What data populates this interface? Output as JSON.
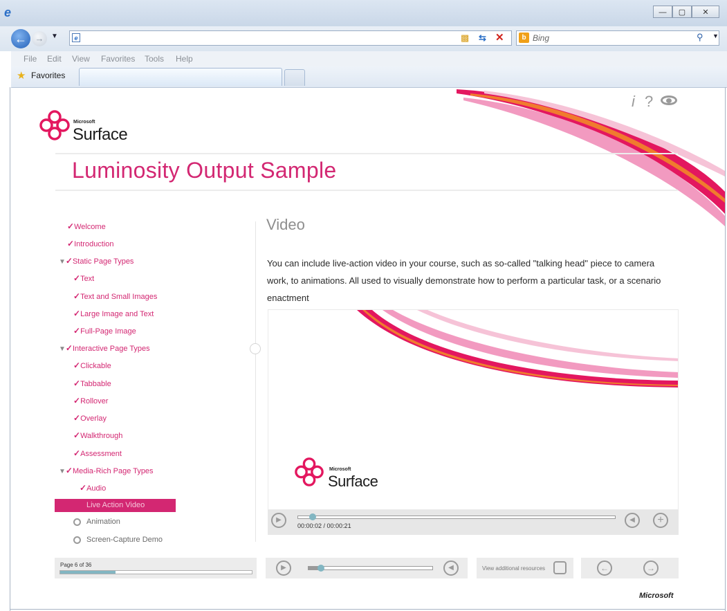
{
  "browser": {
    "search_placeholder": "Bing",
    "menu": [
      "File",
      "Edit",
      "View",
      "Favorites",
      "Tools",
      "Help"
    ],
    "favorites_label": "Favorites",
    "icons": [
      "ie-logo-icon",
      "back-arrow-icon",
      "forward-arrow-icon",
      "lock-icon",
      "refresh-icon",
      "stop-icon",
      "bing-icon",
      "search-icon",
      "favorites-star-icon"
    ]
  },
  "course": {
    "logo_small": "Microsoft",
    "logo_big": "Surface",
    "title": "Luminosity Output Sample",
    "tool_icons": [
      "info-icon",
      "help-icon",
      "eye-icon"
    ],
    "accent_color": "#d32772",
    "toc": [
      {
        "label": "Welcome",
        "level": 1,
        "state": "checked"
      },
      {
        "label": "Introduction",
        "level": 1,
        "state": "checked"
      },
      {
        "label": "Static Page Types",
        "level": 1,
        "state": "expanded-checked"
      },
      {
        "label": "Text",
        "level": 2,
        "state": "checked"
      },
      {
        "label": "Text and Small Images",
        "level": 2,
        "state": "checked"
      },
      {
        "label": "Large Image and Text",
        "level": 2,
        "state": "checked"
      },
      {
        "label": "Full-Page Image",
        "level": 2,
        "state": "checked"
      },
      {
        "label": "Interactive Page Types",
        "level": 1,
        "state": "expanded-checked"
      },
      {
        "label": "Clickable",
        "level": 2,
        "state": "checked"
      },
      {
        "label": "Tabbable",
        "level": 2,
        "state": "checked"
      },
      {
        "label": "Rollover",
        "level": 2,
        "state": "checked"
      },
      {
        "label": "Overlay",
        "level": 2,
        "state": "checked"
      },
      {
        "label": "Walkthrough",
        "level": 2,
        "state": "checked"
      },
      {
        "label": "Assessment",
        "level": 2,
        "state": "checked"
      },
      {
        "label": "Media-Rich Page Types",
        "level": 1,
        "state": "expanded-checked"
      },
      {
        "label": "Audio",
        "level": 2,
        "state": "checked"
      },
      {
        "label": "Live Action Video",
        "level": 2,
        "state": "selected"
      },
      {
        "label": "Animation",
        "level": 2,
        "state": "locked"
      },
      {
        "label": "Screen-Capture Demo",
        "level": 2,
        "state": "locked"
      }
    ],
    "page_heading": "Video",
    "page_body": "You can include live-action video in your course, such as so-called \"talking head\" piece to camera work, to animations. All used to visually demonstrate how to perform a particular task, or a scenario enactment",
    "video": {
      "logo_small": "Microsoft",
      "logo_big": "Surface",
      "time": "00:00:02 / 00:00:21",
      "progress": 0.048
    },
    "footer": {
      "page_count": "Page 6 of 36",
      "progress": 0.29,
      "resources_label": "View additional resources",
      "brand": "Microsoft"
    }
  }
}
